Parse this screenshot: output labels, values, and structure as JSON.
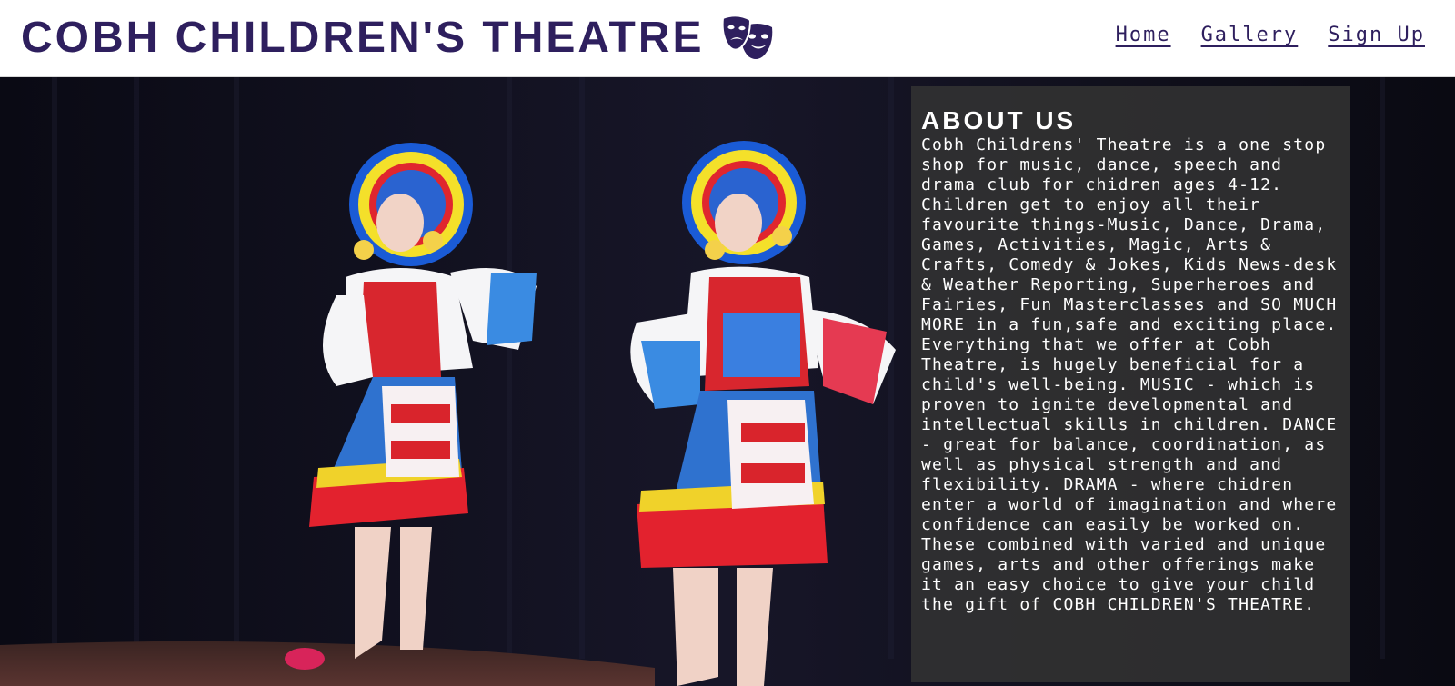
{
  "header": {
    "title": "COBH CHILDREN'S THEATRE",
    "logo_icon": "theatre-masks-icon",
    "accent_color": "#2e1f5e"
  },
  "nav": {
    "items": [
      {
        "label": "Home"
      },
      {
        "label": "Gallery"
      },
      {
        "label": "Sign Up"
      }
    ]
  },
  "hero": {
    "image": "two girls dancing in colorful folk costumes on stage"
  },
  "about": {
    "heading": "ABOUT US",
    "text": "Cobh Childrens' Theatre is a one stop shop for music, dance, speech and drama club for chidren ages 4-12. Children get to enjoy all their favourite things-Music, Dance, Drama, Games, Activities, Magic, Arts & Crafts, Comedy & Jokes, Kids News-desk & Weather Reporting, Superheroes and Fairies, Fun Masterclasses and SO MUCH MORE in a fun,safe and exciting place. Everything that we offer at Cobh Theatre, is hugely beneficial for a child's well-being. MUSIC - which is proven to ignite developmental and intellectual skills in children. DANCE - great for balance, coordination, as well as physical strength and and flexibility. DRAMA - where chidren enter a world of imagination and where confidence can easily be worked on. These combined with varied and unique games, arts and other offerings make it an easy choice to give your child the gift of COBH CHILDREN'S THEATRE."
  }
}
